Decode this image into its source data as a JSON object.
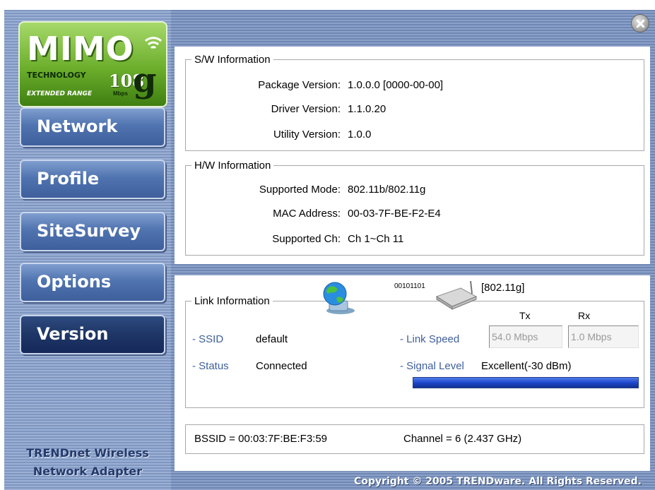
{
  "logo": {
    "brand_text": "MIMO",
    "tech_text": "TECHNOLOGY",
    "speed_text": "108",
    "speed_suffix": "g",
    "speed_unit": "Mbps",
    "tagline": "EXTENDED RANGE"
  },
  "nav": {
    "items": [
      {
        "label": "Network",
        "active": false
      },
      {
        "label": "Profile",
        "active": false
      },
      {
        "label": "SiteSurvey",
        "active": false
      },
      {
        "label": "Options",
        "active": false
      },
      {
        "label": "Version",
        "active": true
      }
    ]
  },
  "brand": {
    "line1": "TRENDnet Wireless",
    "line2": "Network Adapter"
  },
  "sw_info": {
    "legend": "S/W Information",
    "rows": [
      {
        "label": "Package Version:",
        "value": "1.0.0.0 [0000-00-00]"
      },
      {
        "label": "Driver Version:",
        "value": "1.1.0.20"
      },
      {
        "label": "Utility Version:",
        "value": "1.0.0"
      }
    ]
  },
  "hw_info": {
    "legend": "H/W Information",
    "rows": [
      {
        "label": "Supported Mode:",
        "value": "802.11b/802.11g"
      },
      {
        "label": "MAC Address:",
        "value": "00-03-7F-BE-F2-E4"
      },
      {
        "label": "Supported Ch:",
        "value": "Ch 1~Ch 11"
      }
    ]
  },
  "link_info": {
    "legend": "Link Information",
    "binary_text": "00101101",
    "mode_label": "[802.11g]",
    "tx_header": "Tx",
    "rx_header": "Rx",
    "ssid_label": "- SSID",
    "ssid_value": "default",
    "status_label": "- Status",
    "status_value": "Connected",
    "speed_label": "- Link Speed",
    "tx_value": "54.0 Mbps",
    "rx_value": "1.0 Mbps",
    "signal_label": "- Signal Level",
    "signal_value": "Excellent(-30 dBm)",
    "signal_fraction": 1.0
  },
  "footer": {
    "bssid": "BSSID = 00:03:7F:BE:F3:59",
    "channel": "Channel = 6 (2.437 GHz)",
    "copyright": "Copyright © 2005 TRENDware. All Rights Reserved."
  },
  "icons": {
    "network": "network-globe-icon",
    "router": "wireless-router-icon",
    "close": "close-icon",
    "wifi": "wifi-icon"
  },
  "colors": {
    "accent": "#3e5f9c",
    "signal": "#1b44c8",
    "logo_green": "#6cae2c"
  }
}
